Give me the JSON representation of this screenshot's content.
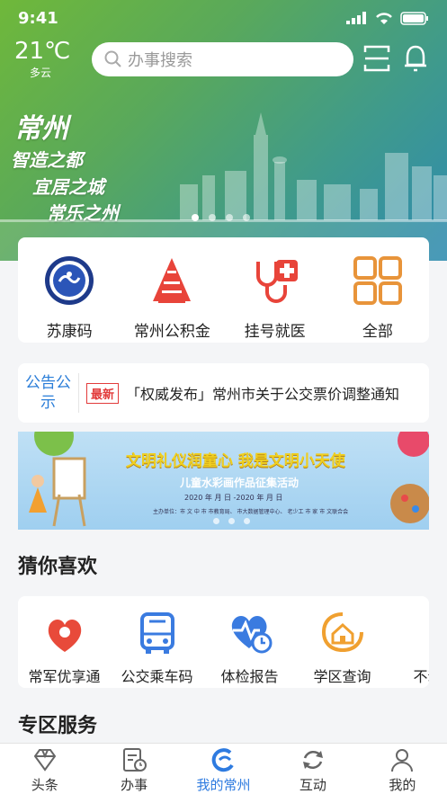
{
  "status_bar": {
    "time": "9:41"
  },
  "weather": {
    "temperature": "21℃",
    "condition": "多云"
  },
  "search": {
    "placeholder": "办事搜索"
  },
  "hero": {
    "city": "常州",
    "slogans": [
      "智造之都",
      "宜居之城",
      "常乐之州"
    ],
    "carousel_count": 4,
    "active_index": 0
  },
  "quick_services": [
    {
      "label": "苏康码",
      "icon": "sukang-code-icon"
    },
    {
      "label": "常州公积金",
      "icon": "housing-fund-icon"
    },
    {
      "label": "挂号就医",
      "icon": "stethoscope-icon"
    },
    {
      "label": "全部",
      "icon": "grid-icon"
    }
  ],
  "notice": {
    "tag": "公告公示",
    "badge": "最新",
    "text": "「权威发布」常州市关于公交票价调整通知"
  },
  "banner": {
    "title": "文明礼仪润童心  我是文明小天使",
    "subtitle": "儿童水彩画作品征集活动",
    "dates": "2020 年  月  日 -2020 年  月  日",
    "organizers": "主办单位：市 文 中 市  市教育局、 市大数据管理中心、 老少工 市 家 市 文联合会",
    "carousel_count": 3
  },
  "sections": {
    "guess": "猜你喜欢",
    "zone": "专区服务"
  },
  "guess_items": [
    {
      "label": "常军优享通",
      "icon": "military-icon"
    },
    {
      "label": "公交乘车码",
      "icon": "bus-icon"
    },
    {
      "label": "体检报告",
      "icon": "health-check-icon"
    },
    {
      "label": "学区查询",
      "icon": "school-district-icon"
    },
    {
      "label": "不动产",
      "icon": "building-icon"
    }
  ],
  "tabs": [
    {
      "label": "头条",
      "icon": "diamond-icon"
    },
    {
      "label": "办事",
      "icon": "document-clock-icon"
    },
    {
      "label": "我的常州",
      "icon": "city-logo-icon",
      "active": true
    },
    {
      "label": "互动",
      "icon": "refresh-icon"
    },
    {
      "label": "我的",
      "icon": "person-icon"
    }
  ],
  "colors": {
    "accent": "#2e7be0",
    "hero_green": "#6fb83a",
    "hero_blue": "#2f8bb0",
    "alert_red": "#e23b3b"
  }
}
